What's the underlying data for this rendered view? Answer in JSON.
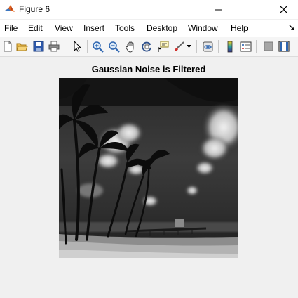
{
  "window": {
    "title": "Figure 6",
    "controls": [
      "minimize",
      "maximize",
      "close"
    ]
  },
  "menubar": {
    "items": [
      "File",
      "Edit",
      "View",
      "Insert",
      "Tools",
      "Desktop",
      "Window",
      "Help"
    ]
  },
  "toolbar": {
    "buttons": [
      "new-figure-icon",
      "open-file-icon",
      "save-icon",
      "print-icon",
      "edit-plot-icon",
      "zoom-in-icon",
      "zoom-out-icon",
      "pan-icon",
      "rotate-3d-icon",
      "data-cursor-icon",
      "brush-icon",
      "link-plot-icon",
      "insert-colorbar-icon",
      "insert-legend-icon",
      "hide-plot-tools-icon",
      "show-plot-tools-icon"
    ]
  },
  "figure": {
    "axes_title": "Gaussian Noise is Filtered",
    "image_description": "grayscale"
  }
}
